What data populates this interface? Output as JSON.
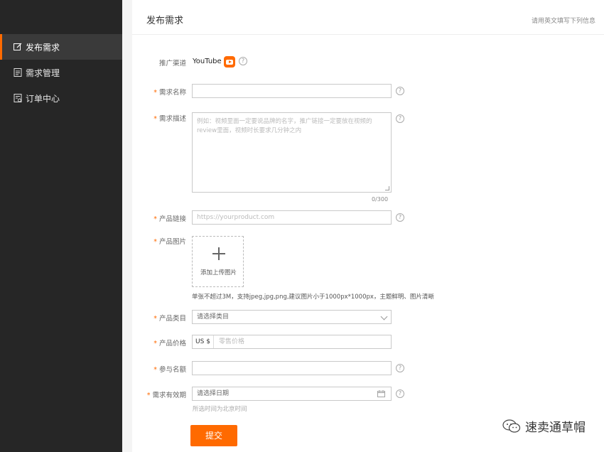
{
  "sidebar": {
    "items": [
      {
        "label": "发布需求",
        "icon": "edit-icon",
        "active": true
      },
      {
        "label": "需求管理",
        "icon": "document-icon",
        "active": false
      },
      {
        "label": "订单中心",
        "icon": "orders-icon",
        "active": false
      }
    ]
  },
  "header": {
    "title": "发布需求",
    "hint": "请用英文填写下列信息"
  },
  "form": {
    "channel": {
      "label": "推广渠道",
      "value": "YouTube",
      "icon": "youtube-icon"
    },
    "name": {
      "label": "需求名称",
      "value": ""
    },
    "description": {
      "label": "需求描述",
      "placeholder": "例如：视频里面一定要说品牌的名字，推广链接一定要放在视频的review里面，视频时长要求几分钟之内",
      "counter": "0/300"
    },
    "link": {
      "label": "产品链接",
      "placeholder": "https://yourproduct.com"
    },
    "image": {
      "label": "产品图片",
      "upload_text": "添加上传图片",
      "note": "单张不超过3M，支持jpeg,jpg,png,建议图片小于1000px*1000px，主题鲜明、图片清晰"
    },
    "category": {
      "label": "产品类目",
      "placeholder": "请选择类目"
    },
    "price": {
      "label": "产品价格",
      "prefix": "US $",
      "placeholder": "零售价格"
    },
    "quota": {
      "label": "参与名额",
      "value": ""
    },
    "validity": {
      "label": "需求有效期",
      "placeholder": "请选择日期",
      "note": "所选时间为北京时间"
    },
    "required_mark": "*",
    "help_glyph": "?",
    "submit_label": "提交"
  },
  "watermark": {
    "text": "速卖通草帽"
  },
  "colors": {
    "accent": "#ff6a00",
    "sidebar_bg": "#262626",
    "sidebar_active": "#3a3a3a"
  }
}
